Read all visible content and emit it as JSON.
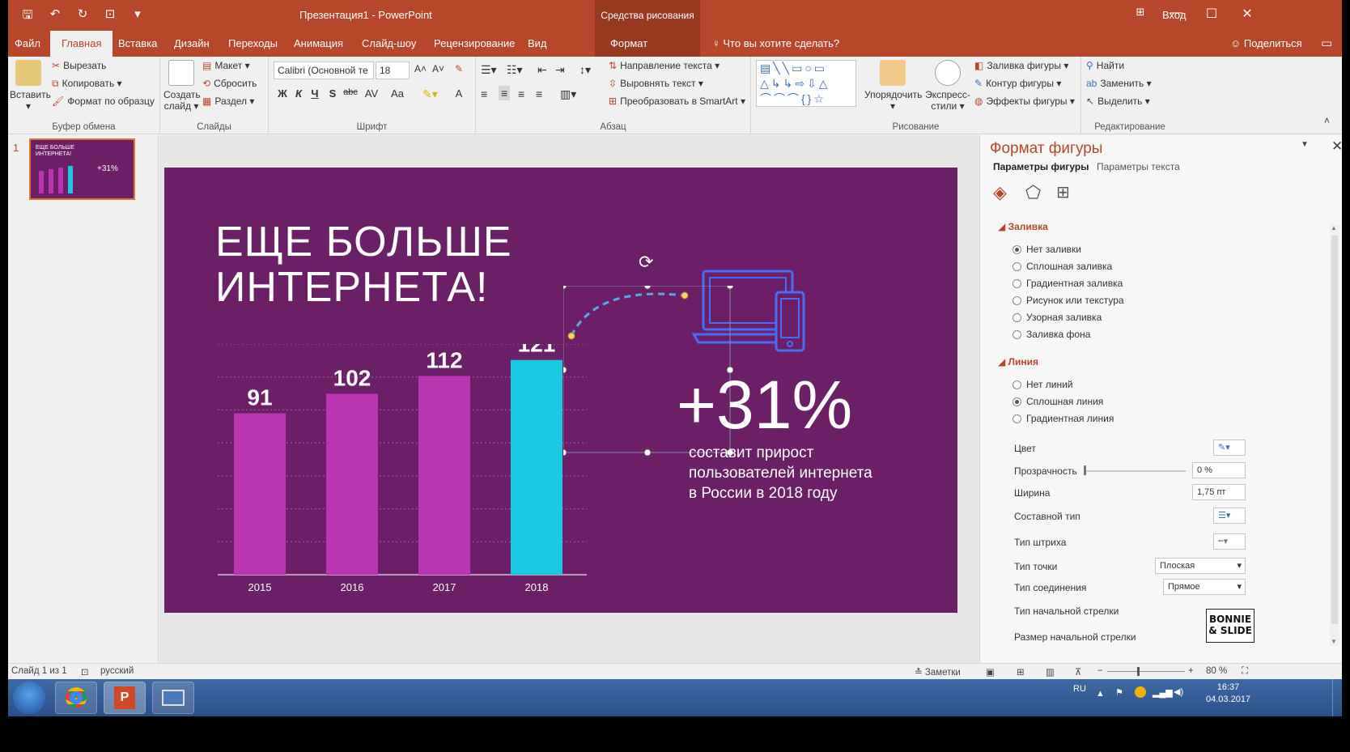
{
  "titlebar": {
    "doc_title": "Презентация1  -  PowerPoint",
    "context_title": "Средства рисования",
    "signin": "Вход",
    "minimize": "—",
    "maximize": "☐",
    "close": "✕"
  },
  "tabs": {
    "items": [
      "Файл",
      "Главная",
      "Вставка",
      "Дизайн",
      "Переходы",
      "Анимация",
      "Слайд-шоу",
      "Рецензирование",
      "Вид",
      "Формат"
    ],
    "active": "Главная",
    "search": "Что вы хотите сделать?",
    "share": "Поделиться"
  },
  "ribbon": {
    "clipboard": {
      "group": "Буфер обмена",
      "paste": "Вставить",
      "cut": "Вырезать",
      "copy": "Копировать",
      "format_painter": "Формат по образцу"
    },
    "slides": {
      "group": "Слайды",
      "new_slide_1": "Создать",
      "new_slide_2": "слайд",
      "layout": "Макет",
      "reset": "Сбросить",
      "section": "Раздел"
    },
    "font": {
      "group": "Шрифт",
      "font_name": "Calibri (Основной те",
      "font_size": "18",
      "bold": "Ж",
      "italic": "К",
      "underline": "Ч",
      "shadow": "S",
      "strike": "abc",
      "spacing": "AV",
      "case": "Aa",
      "color": "A"
    },
    "paragraph": {
      "group": "Абзац",
      "text_direction": "Направление текста",
      "align_text": "Выровнять текст",
      "smartart": "Преобразовать в SmartArt"
    },
    "drawing": {
      "group": "Рисование",
      "arrange": "Упорядочить",
      "quick_styles_1": "Экспресс-",
      "quick_styles_2": "стили",
      "shape_fill": "Заливка фигуры",
      "shape_outline": "Контур фигуры",
      "shape_effects": "Эффекты фигуры"
    },
    "editing": {
      "group": "Редактирование",
      "find": "Найти",
      "replace": "Заменить",
      "select": "Выделить"
    }
  },
  "slide_pane": {
    "slide_number": "1",
    "thumb_title": "ЕЩЕ БОЛЬШЕ ИНТЕРНЕТА!",
    "thumb_pct": "+31%"
  },
  "slide": {
    "title": "ЕЩЕ БОЛЬШЕ\nИНТЕРНЕТА!",
    "big_number": "+31%",
    "subtitle": "составит прирост\nпользователей интернета\nв России в 2018 году"
  },
  "chart_data": {
    "type": "bar",
    "categories": [
      "2015",
      "2016",
      "2017",
      "2018"
    ],
    "values": [
      91,
      102,
      112,
      121
    ],
    "ylim": [
      0,
      130
    ],
    "bar_colors": [
      "#b936b0",
      "#b936b0",
      "#b936b0",
      "#1ac8e0"
    ],
    "grid": true
  },
  "format_pane": {
    "title": "Формат фигуры",
    "tab_shape": "Параметры фигуры",
    "tab_text": "Параметры текста",
    "fill_section": "Заливка",
    "fill_options": [
      "Нет заливки",
      "Сплошная заливка",
      "Градиентная заливка",
      "Рисунок или текстура",
      "Узорная заливка",
      "Заливка фона"
    ],
    "fill_selected": 0,
    "line_section": "Линия",
    "line_options": [
      "Нет линий",
      "Сплошная линия",
      "Градиентная линия"
    ],
    "line_selected": 1,
    "color_label": "Цвет",
    "transparency_label": "Прозрачность",
    "transparency_value": "0 %",
    "width_label": "Ширина",
    "width_value": "1,75 пт",
    "compound_label": "Составной тип",
    "dash_label": "Тип штриха",
    "cap_label": "Тип точки",
    "cap_value": "Плоская",
    "join_label": "Тип соединения",
    "join_value": "Прямое",
    "begin_arrow_type": "Тип начальной стрелки",
    "begin_arrow_size": "Размер начальной стрелки"
  },
  "statusbar": {
    "slide_info": "Слайд 1 из 1",
    "language": "русский",
    "notes": "Заметки",
    "zoom": "80 %"
  },
  "taskbar": {
    "lang": "RU",
    "time": "16:37",
    "date": "04.03.2017"
  },
  "watermark": {
    "text": "BONNIE & SLIDE"
  },
  "colors": {
    "accent": "#b7472a",
    "slide_bg": "#6b1f67",
    "bar": "#b936b0",
    "bar_highlight": "#1ac8e0",
    "outline": "#4a6cf0"
  }
}
